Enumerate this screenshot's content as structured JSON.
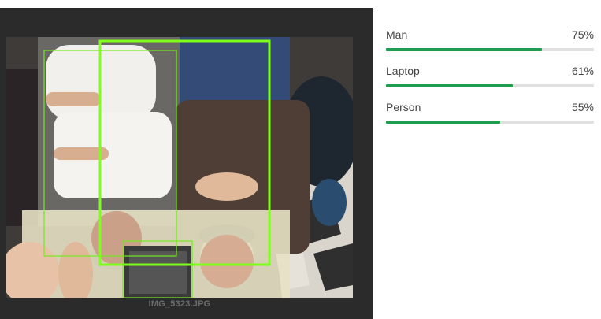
{
  "image": {
    "filename": "IMG_5323.JPG"
  },
  "labels": [
    {
      "name": "Man",
      "percent_text": "75%",
      "score": 0.75
    },
    {
      "name": "Laptop",
      "percent_text": "61%",
      "score": 0.61
    },
    {
      "name": "Person",
      "percent_text": "55%",
      "score": 0.55
    }
  ],
  "colors": {
    "bar_fill": "#1e9e4e",
    "bar_track": "#e1e1e1",
    "box_highlight": "#7dff1a",
    "box_normal": "#76e81e",
    "panel_dark": "#2b2b2b"
  }
}
